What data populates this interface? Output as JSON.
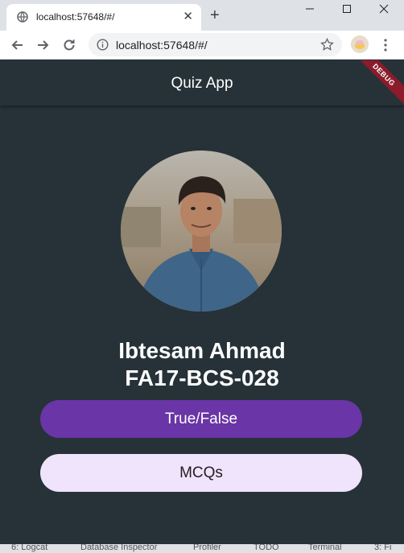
{
  "browser": {
    "tab_title": "localhost:57648/#/",
    "url": "localhost:57648/#/",
    "new_tab": "+",
    "close_tab": "✕"
  },
  "app": {
    "title": "Quiz App",
    "debug_banner": "DEBUG"
  },
  "profile": {
    "name": "Ibtesam Ahmad",
    "id": "FA17-BCS-028"
  },
  "buttons": {
    "true_false": "True/False",
    "mcqs": "MCQs"
  },
  "ide_tools": [
    "6: Logcat",
    "Database Inspector",
    "Profiler",
    "TODO",
    "Terminal",
    "3: Fi"
  ],
  "colors": {
    "background": "#263238",
    "primary_button": "#6a35a6",
    "secondary_button": "#efe4fb",
    "debug_banner": "#8c1b2b"
  },
  "icons": [
    "globe-icon",
    "back-arrow-icon",
    "forward-arrow-icon",
    "reload-icon",
    "info-icon",
    "star-icon",
    "menu-icon",
    "minimize-icon",
    "maximize-icon",
    "window-close-icon"
  ]
}
